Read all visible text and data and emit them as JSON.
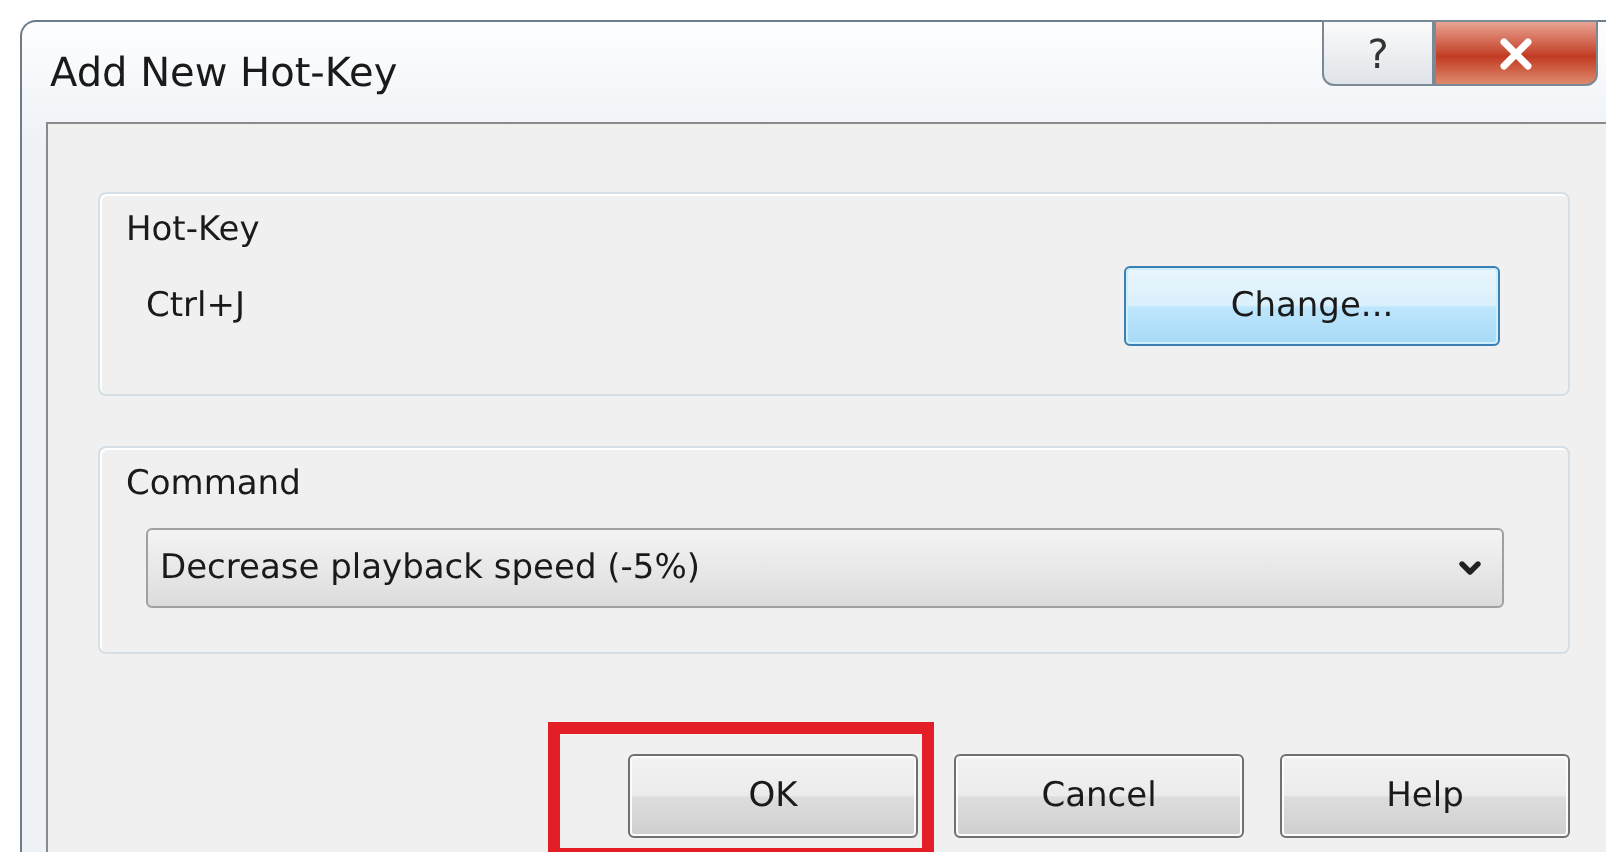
{
  "window": {
    "title": "Add New Hot-Key",
    "help_glyph": "?"
  },
  "hotkey_group": {
    "label": "Hot-Key",
    "value": "Ctrl+J",
    "button": "Change..."
  },
  "command_group": {
    "label": "Command",
    "value": "Decrease playback speed (-5%)"
  },
  "buttons": [
    {
      "label": "OK",
      "highlighted": true
    },
    {
      "label": "Cancel",
      "highlighted": false
    },
    {
      "label": "Help",
      "highlighted": false
    }
  ]
}
